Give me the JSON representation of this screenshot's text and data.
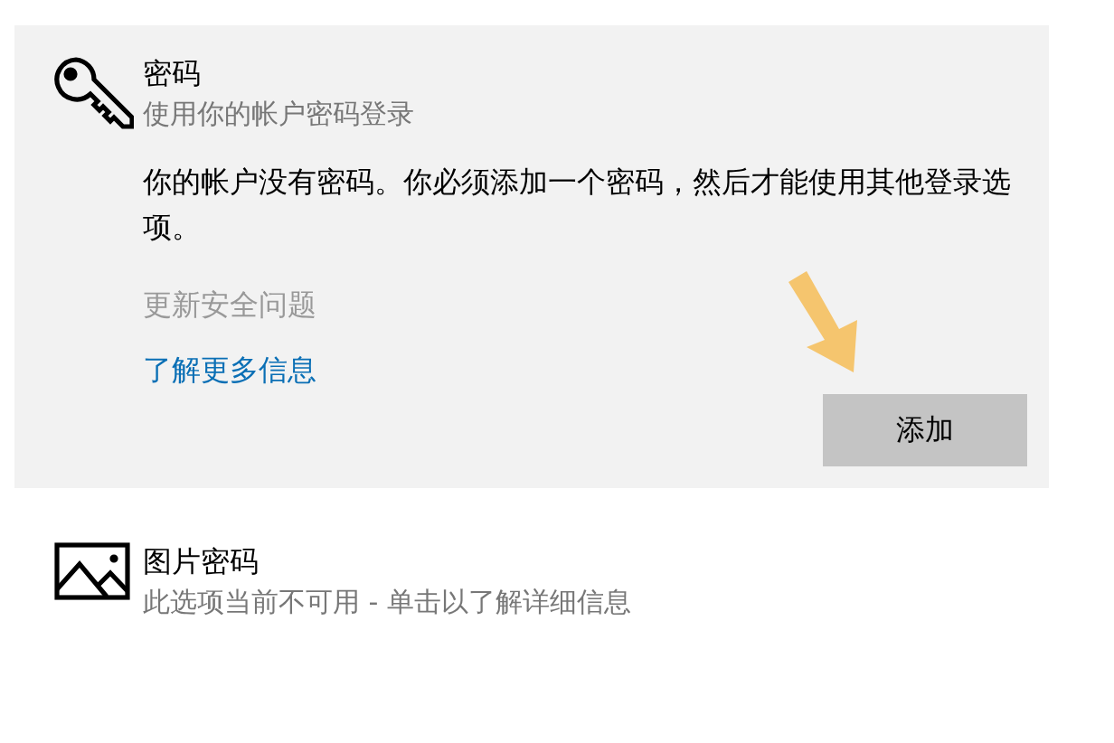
{
  "options": [
    {
      "kind": "key",
      "title": "密码",
      "subtitle": "使用你的帐户密码登录",
      "expanded": true,
      "message": "你的帐户没有密码。你必须添加一个密码，然后才能使用其他登录选项。",
      "links": [
        {
          "label": "更新安全问题",
          "disabled": true
        },
        {
          "label": "了解更多信息",
          "disabled": false
        }
      ],
      "button": "添加"
    },
    {
      "kind": "picture",
      "title": "图片密码",
      "subtitle": "此选项当前不可用 - 单击以了解详细信息",
      "expanded": false
    }
  ]
}
